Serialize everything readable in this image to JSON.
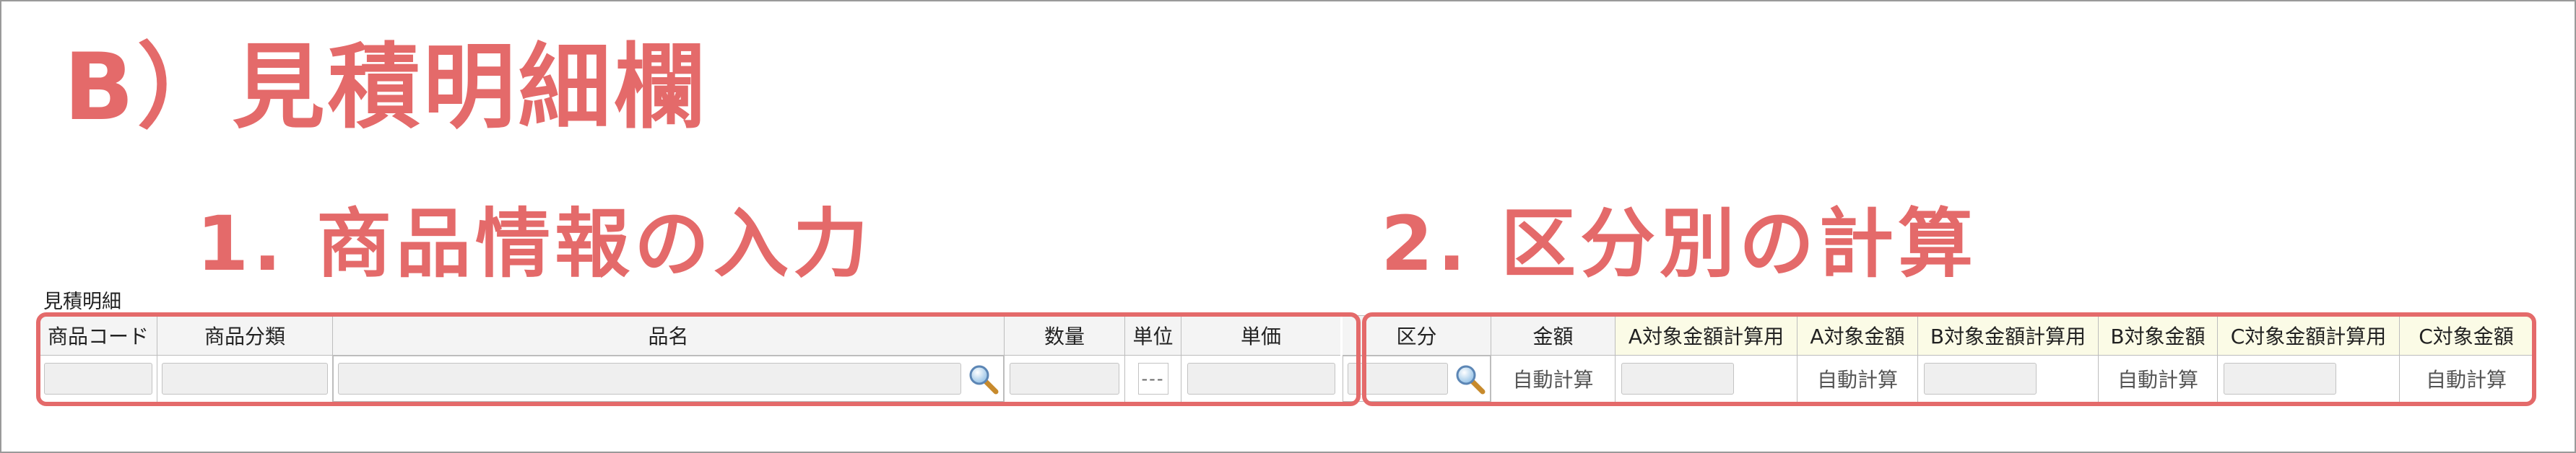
{
  "title": "B）見積明細欄",
  "subheadings": {
    "product_input": "1. 商品情報の入力",
    "category_calc": "2. 区分別の計算"
  },
  "section_caption": "見積明細",
  "columns": [
    "商品コード",
    "商品分類",
    "品名",
    "数量",
    "単位",
    "単価",
    "区分",
    "金額",
    "A対象金額計算用",
    "A対象金額",
    "B対象金額計算用",
    "B対象金額",
    "C対象金額計算用",
    "C対象金額"
  ],
  "row": {
    "unit_placeholder": "---",
    "amount": "自動計算",
    "a_amount": "自動計算",
    "b_amount": "自動計算",
    "c_amount": "自動計算"
  },
  "icons": {
    "product_lookup": "search-icon",
    "category_lookup": "search-icon"
  },
  "colors": {
    "accent": "#e46a6a",
    "header_bg": "#f4f4f4",
    "calc_header_bg": "#fbfbe6",
    "field_bg": "#efefef"
  }
}
